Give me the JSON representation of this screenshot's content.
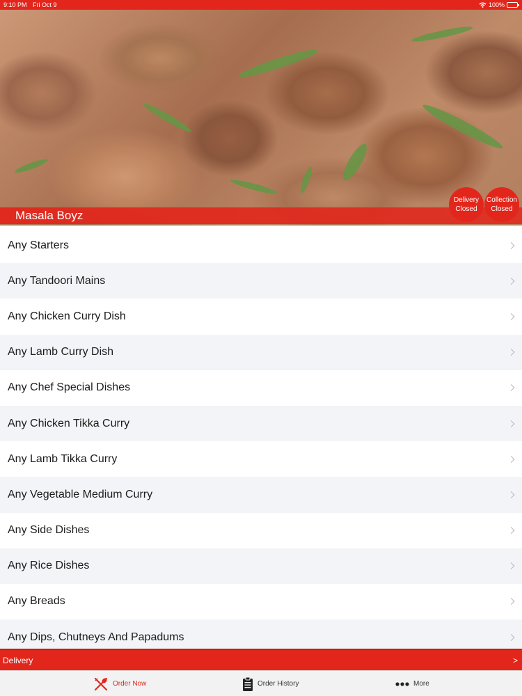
{
  "status_bar": {
    "time": "9:10 PM",
    "date": "Fri Oct 9",
    "battery": "100%",
    "icons": [
      "wifi-icon",
      "battery-icon"
    ]
  },
  "restaurant": {
    "name": "Masala Boyz",
    "delivery_status": {
      "line1": "Delivery",
      "line2": "Closed"
    },
    "collection_status": {
      "line1": "Collection",
      "line2": "Closed"
    }
  },
  "menu": {
    "items": [
      {
        "label": "Any Starters"
      },
      {
        "label": "Any Tandoori Mains"
      },
      {
        "label": "Any Chicken Curry Dish"
      },
      {
        "label": "Any Lamb Curry Dish"
      },
      {
        "label": "Any Chef Special Dishes"
      },
      {
        "label": "Any Chicken Tikka Curry"
      },
      {
        "label": "Any Lamb Tikka Curry"
      },
      {
        "label": "Any Vegetable Medium Curry"
      },
      {
        "label": "Any Side Dishes"
      },
      {
        "label": "Any Rice Dishes"
      },
      {
        "label": "Any Breads"
      },
      {
        "label": "Any Dips, Chutneys And Papadums"
      }
    ]
  },
  "order_bar": {
    "mode": "Delivery",
    "arrow": ">"
  },
  "tabs": [
    {
      "label": "Order Now",
      "icon": "fork-knife-icon",
      "active": true
    },
    {
      "label": "Order History",
      "icon": "clipboard-icon",
      "active": false
    },
    {
      "label": "More",
      "icon": "more-dots-icon",
      "active": false
    }
  ],
  "colors": {
    "brand_red": "#e2261c",
    "row_alt": "#f2f4f7",
    "tab_bar_bg": "#f2f2f2"
  }
}
